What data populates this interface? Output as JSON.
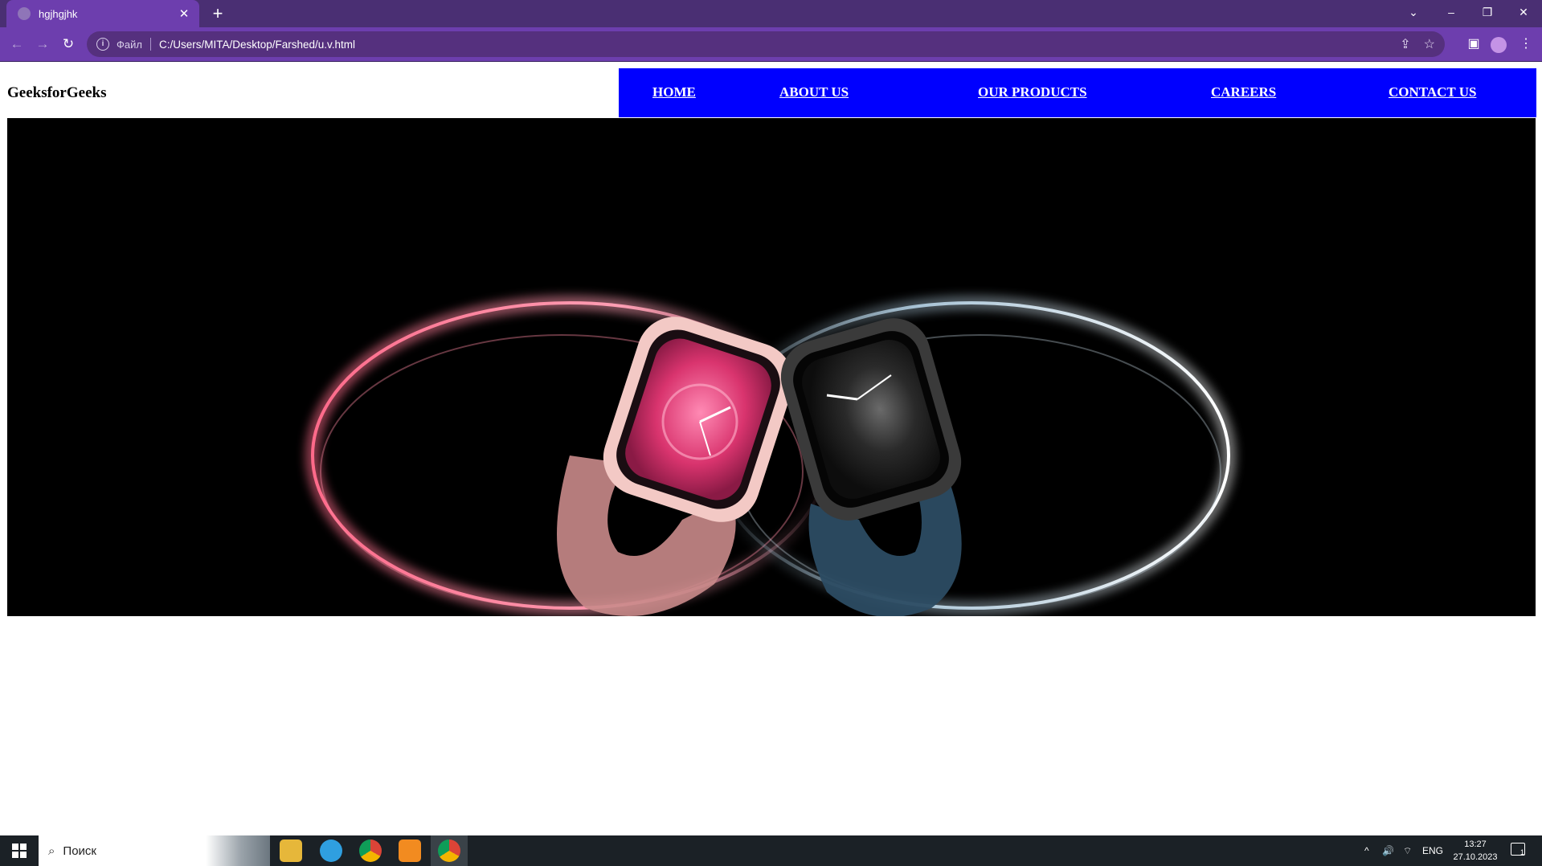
{
  "browser": {
    "tab_title": "hgjhgjhk",
    "tab_close": "✕",
    "new_tab": "+",
    "site_info": "Файл",
    "url": "C:/Users/MITA/Desktop/Farshed/u.v.html",
    "controls": {
      "list": "⌄",
      "minimize": "–",
      "restore": "❐",
      "close": "✕"
    },
    "nav": {
      "back": "←",
      "forward": "→",
      "reload": "↻"
    },
    "omni_icons": {
      "share": "⇪",
      "bookmark": "☆"
    },
    "toolbar_icons": {
      "sidepanel": "▣",
      "menu": "⋮"
    }
  },
  "site": {
    "logo": "GeeksforGeeks",
    "nav": [
      "HOME",
      "ABOUT US",
      "OUR PRODUCTS",
      "CAREERS",
      "CONTACT US"
    ],
    "nav_color": "#0000ff",
    "hero_alt": "Apple Watch banner"
  },
  "taskbar": {
    "search_placeholder": "Поиск",
    "tray_chevron": "^",
    "tray_volume": "🔊",
    "tray_network": "⌔",
    "language": "ENG",
    "time": "13:27",
    "date": "27.10.2023",
    "notifications": "1"
  }
}
